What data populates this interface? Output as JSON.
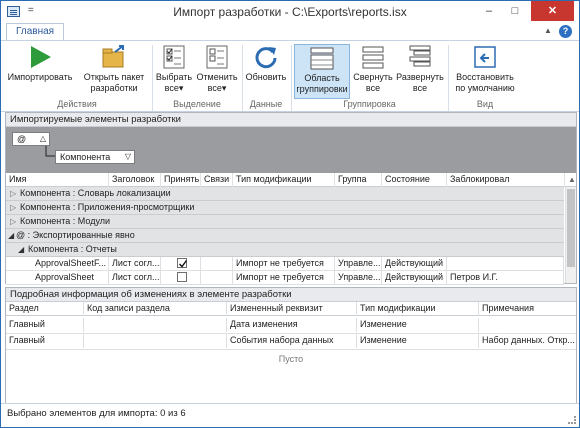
{
  "window": {
    "title": "Импорт разработки - C:\\Exports\\reports.isx",
    "quick_access": "=",
    "minimize": "–",
    "maximize": "□",
    "close": "✕"
  },
  "tabs": {
    "main": "Главная",
    "help": "?"
  },
  "ribbon": {
    "import": "Импортировать",
    "open_package": "Открыть пакет разработки",
    "select_all": "Выбрать все",
    "deselect_all": "Отменить все",
    "refresh": "Обновить",
    "group_area": "Область группировки",
    "collapse_all": "Свернуть все",
    "expand_all": "Развернуть все",
    "restore_default": "Восстановить по умолчанию",
    "group_actions": "Действия",
    "group_selection": "Выделение",
    "group_data": "Данные",
    "group_grouping": "Группировка",
    "group_view": "Вид",
    "dropdown": "▾"
  },
  "top_pane": {
    "title": "Импортируемые элементы разработки",
    "chip_at": "@",
    "chip_component": "Компонента",
    "columns": [
      "Имя",
      "Заголовок",
      "Принять",
      "Связи",
      "Тип модификации",
      "Группа",
      "Состояние",
      "Заблокировал"
    ],
    "groups": [
      {
        "label": "Компонента : Словарь локализации"
      },
      {
        "label": "Компонента : Приложения-просмотрщики"
      },
      {
        "label": "Компонента : Модули"
      },
      {
        "label": "@ : Экспортированные явно"
      },
      {
        "label": "Компонента : Отчеты"
      }
    ],
    "rows": [
      {
        "name": "ApprovalSheetF...",
        "caption": "Лист согл...",
        "accept": true,
        "mod_type": "Импорт не требуется",
        "group": "Управле...",
        "state": "Действующий",
        "locked_by": ""
      },
      {
        "name": "ApprovalSheet",
        "caption": "Лист согл...",
        "accept": false,
        "mod_type": "Импорт не требуется",
        "group": "Управле...",
        "state": "Действующий",
        "locked_by": "Петров И.Г."
      }
    ]
  },
  "bottom_pane": {
    "title": "Подробная информация об изменениях в элементе разработки",
    "columns": [
      "Раздел",
      "Код записи раздела",
      "Измененный реквизит",
      "Тип модификации",
      "Примечания"
    ],
    "rows": [
      [
        "Главный",
        "",
        "Дата изменения",
        "Изменение",
        ""
      ],
      [
        "Главный",
        "",
        "События набора данных",
        "Изменение",
        "Набор данных. Откр..."
      ]
    ],
    "empty": "Пусто"
  },
  "status": {
    "text": "Выбрано элементов для импорта: 0 из 6"
  }
}
